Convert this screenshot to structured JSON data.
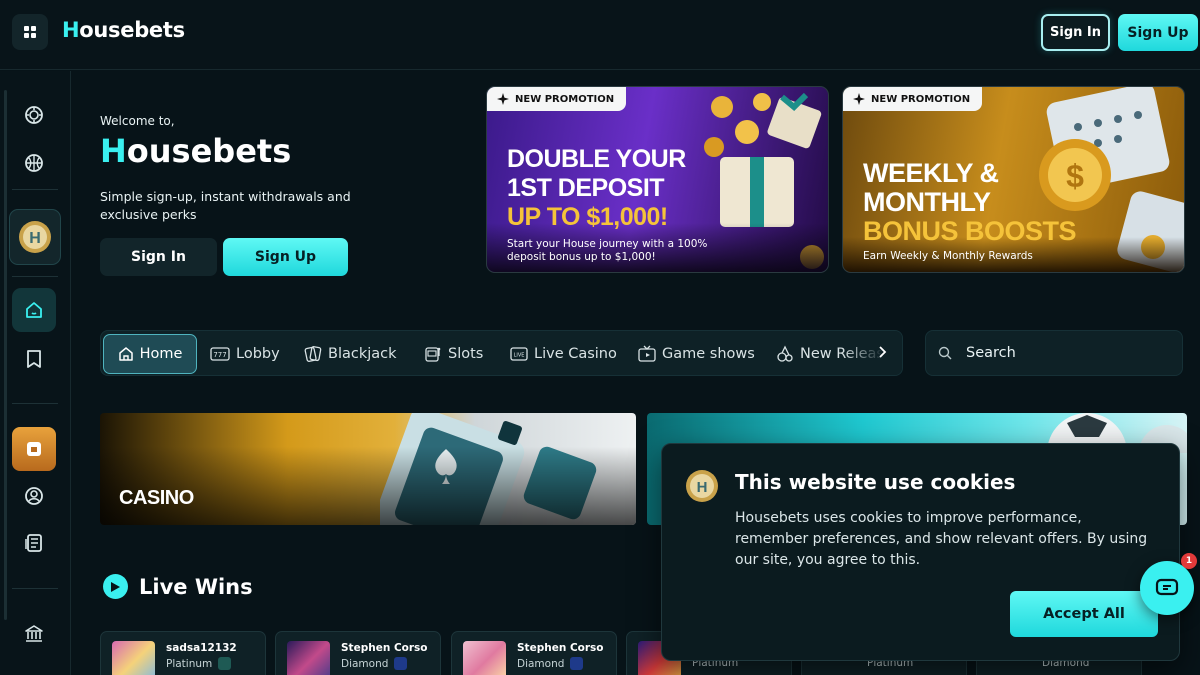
{
  "header": {
    "logo_first": "H",
    "logo_rest": "ousebets",
    "sign_in": "Sign In",
    "sign_up": "Sign Up"
  },
  "sidebar": {
    "items": [
      {
        "name": "casino-chip-icon"
      },
      {
        "name": "basketball-icon"
      },
      {
        "name": "house-coin-icon"
      },
      {
        "name": "home-icon",
        "active": true
      },
      {
        "name": "bookmark-icon"
      },
      {
        "name": "bonus-gift-icon"
      },
      {
        "name": "user-settings-icon"
      },
      {
        "name": "news-icon"
      },
      {
        "name": "bank-icon"
      }
    ]
  },
  "hero": {
    "welcome": "Welcome to,",
    "brand_first": "H",
    "brand_rest": "ousebets",
    "description": "Simple sign-up, instant withdrawals and exclusive perks",
    "sign_in": "Sign In",
    "sign_up": "Sign Up"
  },
  "promos": [
    {
      "tag": "NEW PROMOTION",
      "line1": "DOUBLE YOUR",
      "line2": "1ST DEPOSIT",
      "line3": "UP TO $1,000!",
      "subtitle": "Start your House journey with a 100% deposit bonus up to $1,000!"
    },
    {
      "tag": "NEW PROMOTION",
      "line1": "WEEKLY &",
      "line2": "MONTHLY",
      "line3": "BONUS BOOSTS",
      "subtitle": "Earn Weekly & Monthly Rewards"
    }
  ],
  "nav": {
    "tabs": [
      {
        "label": "Home",
        "icon": "home-icon",
        "active": true
      },
      {
        "label": "Lobby",
        "icon": "slot-777-icon"
      },
      {
        "label": "Blackjack",
        "icon": "cards-icon"
      },
      {
        "label": "Slots",
        "icon": "slot-machine-icon"
      },
      {
        "label": "Live Casino",
        "icon": "live-icon"
      },
      {
        "label": "Game shows",
        "icon": "tv-icon"
      },
      {
        "label": "New Releases",
        "icon": "new-icon"
      }
    ],
    "search_placeholder": "Search"
  },
  "categories": {
    "casino": "CASINO"
  },
  "live_wins": {
    "title": "Live Wins",
    "cards": [
      {
        "name": "sadsa12132",
        "tier": "Platinum",
        "tier_color": "#2fb8a0"
      },
      {
        "name": "Stephen Corso",
        "tier": "Diamond",
        "tier_color": "#3a6ee8"
      },
      {
        "name": "Stephen Corso",
        "tier": "Diamond",
        "tier_color": "#3a6ee8"
      },
      {
        "name": "",
        "tier": "Platinum",
        "tier_color": "#2fb8a0"
      },
      {
        "name": "",
        "tier": "Platinum",
        "tier_color": "#2fb8a0"
      },
      {
        "name": "",
        "tier": "Diamond",
        "tier_color": "#3a6ee8"
      }
    ]
  },
  "cookie": {
    "title": "This website use cookies",
    "text": "Housebets uses cookies to improve performance, remember preferences, and show relevant offers. By using our site, you agree to this.",
    "accept": "Accept All"
  },
  "chat": {
    "badge": "1"
  },
  "colors": {
    "accent": "#3af0f0",
    "background": "#071318",
    "panel": "#0e2126"
  }
}
